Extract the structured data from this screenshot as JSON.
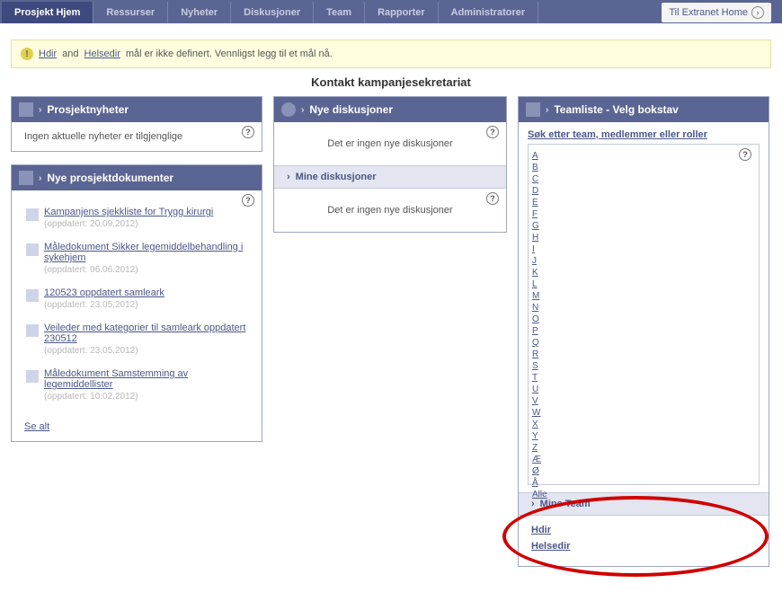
{
  "tabs": [
    {
      "label": "Prosjekt Hjem",
      "active": true
    },
    {
      "label": "Ressurser"
    },
    {
      "label": "Nyheter"
    },
    {
      "label": "Diskusjoner"
    },
    {
      "label": "Team"
    },
    {
      "label": "Rapporter"
    },
    {
      "label": "Administratorer"
    }
  ],
  "extranet_home": "Til Extranet Home",
  "notice": {
    "link1": "Hdir",
    "and": "and",
    "link2": "Helsedir",
    "text": "mål er ikke definert. Vennligst legg til et mål nå."
  },
  "page_title": "Kontakt kampanjesekretariat",
  "news": {
    "title": "Prosjektnyheter",
    "body": "Ingen aktuelle nyheter er tilgjenglige"
  },
  "docs": {
    "title": "Nye prosjektdokumenter",
    "items": [
      {
        "title": "Kampanjens sjekkliste for Trygg kirurgi",
        "meta": "(oppdatert: 20.09.2012)"
      },
      {
        "title": "Måledokument Sikker legemiddelbehandling i sykehjem",
        "meta": "(oppdatert: 06.06.2012)"
      },
      {
        "title": "120523 oppdatert samleark",
        "meta": "(oppdatert: 23.05.2012)"
      },
      {
        "title": "Veileder med kategorier til samleark oppdatert 230512",
        "meta": "(oppdatert: 23.05.2012)"
      },
      {
        "title": "Måledokument Samstemming av legemiddellister",
        "meta": "(oppdatert: 10.02.2012)"
      }
    ],
    "see_all": "Se alt"
  },
  "disc": {
    "new_title": "Nye diskusjoner",
    "new_body": "Det er ingen nye diskusjoner",
    "mine_title": "Mine diskusjoner",
    "mine_body": "Det er ingen nye diskusjoner"
  },
  "teams": {
    "title": "Teamliste - Velg bokstav",
    "search": "Søk etter team, medlemmer eller roller",
    "letters": [
      "A",
      "B",
      "C",
      "D",
      "E",
      "F",
      "G",
      "H",
      "I",
      "J",
      "K",
      "L",
      "M",
      "N",
      "O",
      "P",
      "Q",
      "R",
      "S",
      "T",
      "U",
      "V",
      "W",
      "X",
      "Y",
      "Z",
      "Æ",
      "Ø",
      "Å",
      "Alle"
    ],
    "mine_title": "Mine Team",
    "links": [
      "Hdir",
      "Helsedir"
    ]
  }
}
